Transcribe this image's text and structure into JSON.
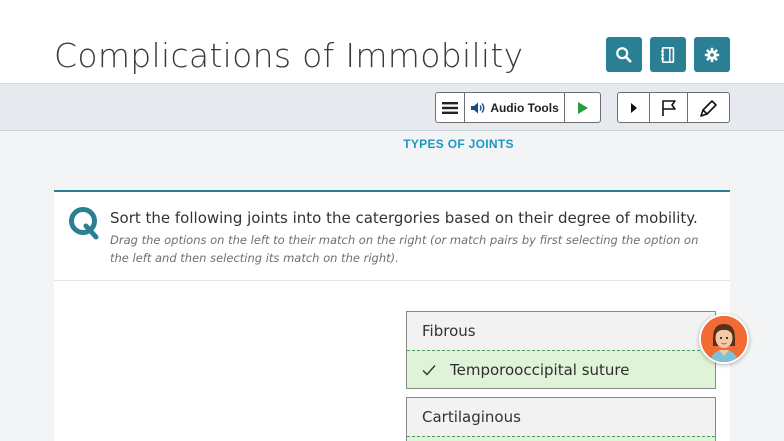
{
  "header": {
    "title": "Complications of Immobility",
    "buttons": [
      {
        "name": "search-button",
        "icon": "search-icon"
      },
      {
        "name": "notebook-button",
        "icon": "notebook-icon"
      },
      {
        "name": "settings-button",
        "icon": "gear-icon"
      }
    ],
    "accent_color": "#2a7f93"
  },
  "toolbar": {
    "audio_tools_label": "Audio Tools",
    "icons": [
      "menu-icon",
      "speaker-icon",
      "play-icon",
      "next-icon",
      "flag-icon",
      "highlighter-icon"
    ]
  },
  "section_title": "TYPES OF JOINTS",
  "question": {
    "text": "Sort the following joints into the catergories based on their degree of mobility.",
    "instructions": "Drag the options on the left to their match on the right (or match pairs by first selecting the option on the left and then selecting its match on the right)."
  },
  "categories": [
    {
      "title": "Fibrous",
      "items": [
        "Temporooccipital suture"
      ]
    },
    {
      "title": "Cartilaginous",
      "items": []
    }
  ],
  "colors": {
    "section_title": "#1a98c2",
    "correct_bg": "#dff3d8",
    "avatar_bg": "#f26b35"
  }
}
